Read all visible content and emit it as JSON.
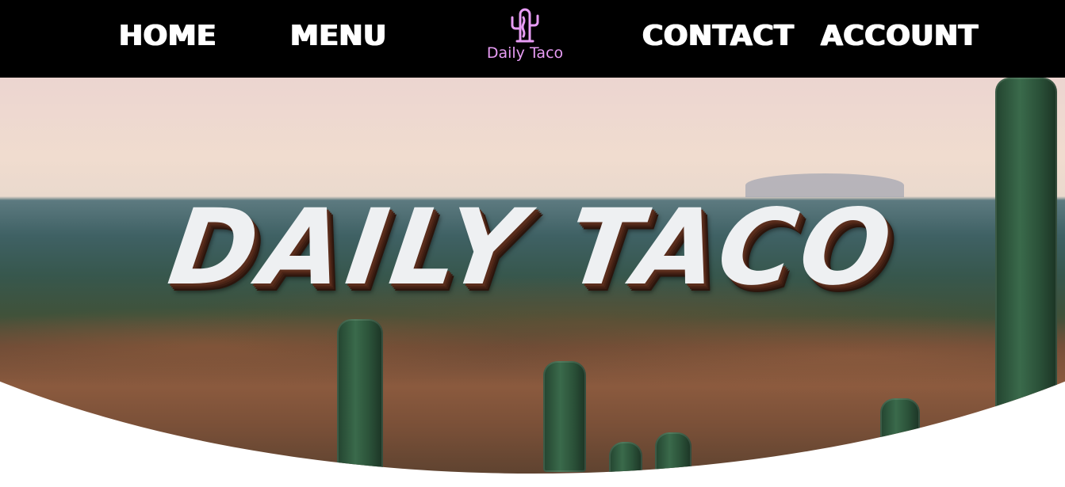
{
  "nav": {
    "home": "HOME",
    "menu": "MENU",
    "contact": "CONTACT",
    "account": "ACCOUNT"
  },
  "logo": {
    "text": "Daily Taco",
    "icon": "cactus-icon",
    "color": "#e79cf4"
  },
  "hero": {
    "title": "DAILY TACO"
  },
  "colors": {
    "navbar_bg": "#000000",
    "nav_text": "#ffffff",
    "hero_title": "#eef0f2"
  }
}
